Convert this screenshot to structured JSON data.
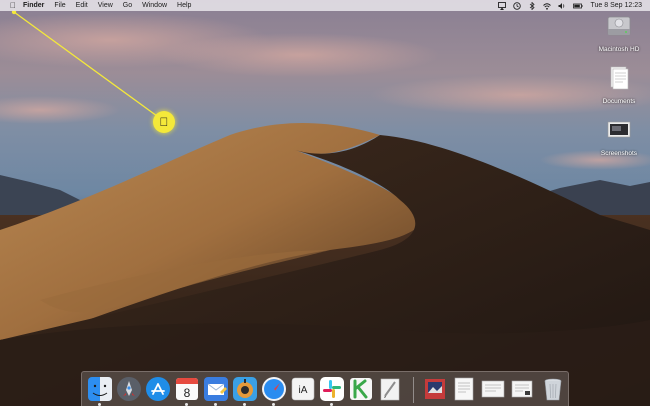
{
  "menubar": {
    "apple_icon": "apple-icon",
    "items": [
      "Finder",
      "File",
      "Edit",
      "View",
      "Go",
      "Window",
      "Help"
    ],
    "clock": "Tue 8 Sep  12:23",
    "status_icons": [
      "airplay-icon",
      "time-machine-icon",
      "bluetooth-icon",
      "wifi-icon",
      "volume-icon",
      "battery-icon"
    ]
  },
  "desktop_icons": [
    {
      "label": "Macintosh HD",
      "icon": "hard-drive-icon"
    },
    {
      "label": "Documents",
      "icon": "documents-folder-icon"
    },
    {
      "label": "Screenshots",
      "icon": "screenshots-icon"
    }
  ],
  "annotation": {
    "icon": "apple-icon",
    "highlight_color": "#f4e93a"
  },
  "dock": {
    "apps": [
      {
        "icon": "finder-icon",
        "running": true
      },
      {
        "icon": "launchpad-icon",
        "running": false
      },
      {
        "icon": "app-store-icon",
        "running": false
      },
      {
        "icon": "calendar-icon",
        "running": true,
        "day": "8"
      },
      {
        "icon": "mail-icon",
        "running": true
      },
      {
        "icon": "tweetbot-icon",
        "running": true
      },
      {
        "icon": "safari-icon",
        "running": true
      },
      {
        "icon": "ia-writer-icon",
        "running": false,
        "text": "iA"
      },
      {
        "icon": "slack-icon",
        "running": true
      },
      {
        "icon": "keynote-icon",
        "running": false
      },
      {
        "icon": "pages-icon",
        "running": false
      }
    ],
    "others": [
      {
        "icon": "image-file-icon"
      },
      {
        "icon": "document-file-icon"
      },
      {
        "icon": "document-file-icon"
      },
      {
        "icon": "document-file-icon"
      },
      {
        "icon": "trash-icon"
      }
    ]
  }
}
